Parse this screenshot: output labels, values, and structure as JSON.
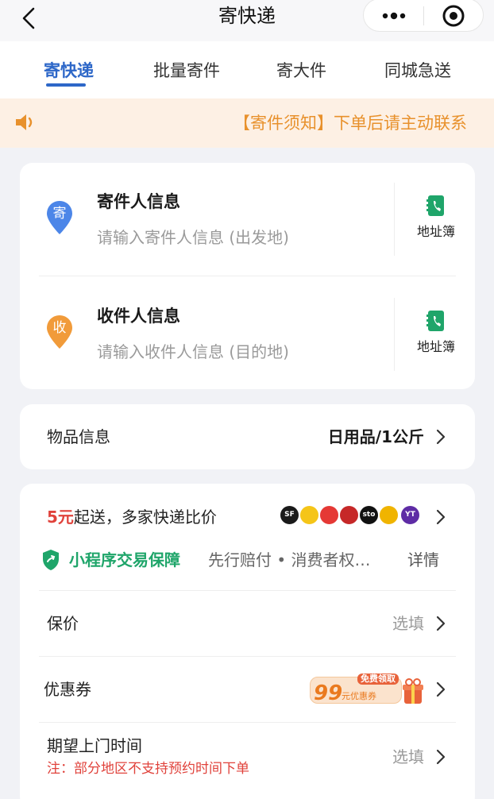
{
  "header": {
    "title": "寄快递",
    "icons": {
      "back": "chevron-left-icon",
      "more": "more-dots-icon",
      "close": "target-circle-icon"
    }
  },
  "tabs": [
    {
      "label": "寄快递",
      "active": true
    },
    {
      "label": "批量寄件",
      "active": false
    },
    {
      "label": "寄大件",
      "active": false
    },
    {
      "label": "同城急送",
      "active": false
    }
  ],
  "notice": {
    "text": "【寄件须知】下单后请主动联系",
    "icon": "speaker-icon"
  },
  "sender": {
    "badge": "寄",
    "title": "寄件人信息",
    "placeholder": "请输入寄件人信息 (出发地)",
    "book_label": "地址簿"
  },
  "receiver": {
    "badge": "收",
    "title": "收件人信息",
    "placeholder": "请输入收件人信息 (目的地)",
    "book_label": "地址簿"
  },
  "goods": {
    "label": "物品信息",
    "value": "日用品/1公斤"
  },
  "compare": {
    "highlight": "5元",
    "text": "起送，多家快递比价",
    "logos": [
      {
        "text": "SF",
        "color": "#1a1a1a"
      },
      {
        "text": "",
        "color": "#f5c518"
      },
      {
        "text": "",
        "color": "#e53935"
      },
      {
        "text": "",
        "color": "#c62828"
      },
      {
        "text": "sto",
        "color": "#111111"
      },
      {
        "text": "",
        "color": "#f0b400"
      },
      {
        "text": "YT",
        "color": "#5e2ca5"
      }
    ]
  },
  "guarantee": {
    "title": "小程序交易保障",
    "desc": "先行赔付 • 消费者权…",
    "detail": "详情"
  },
  "insurance": {
    "label": "保价",
    "value": "选填"
  },
  "coupon": {
    "label": "优惠券",
    "tag": "免费领取",
    "amount": "99",
    "unit_text": "元优惠券"
  },
  "pickup": {
    "label": "期望上门时间",
    "value": "选填",
    "note": "注：部分地区不支持预约时间下单"
  },
  "colors": {
    "accent": "#2d67c8",
    "warning": "#e8912c",
    "red": "#e0423b",
    "green": "#1fa56a"
  }
}
